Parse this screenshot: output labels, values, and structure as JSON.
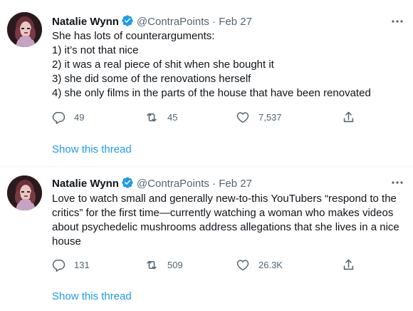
{
  "tweets": [
    {
      "author_name": "Natalie Wynn",
      "handle": "@ContraPoints",
      "separator": "·",
      "date": "Feb 27",
      "text_lines": [
        "She has lots of counterarguments:",
        "1) it’s not that nice",
        "2) it was a real piece of shit when she bought it",
        "3) she did some of the renovations herself",
        "4) she only films in the parts of the house that have been renovated"
      ],
      "replies": "49",
      "retweets": "45",
      "likes": "7,537",
      "show_thread": "Show this thread"
    },
    {
      "author_name": "Natalie Wynn",
      "handle": "@ContraPoints",
      "separator": "·",
      "date": "Feb 27",
      "text": "Love to watch small and generally new-to-this YouTubers “respond to the critics” for the first time—currently watching a woman who makes videos about psychedelic mushrooms address allegations that she lives in a nice house",
      "replies": "131",
      "retweets": "509",
      "likes": "26.3K",
      "show_thread": "Show this thread"
    }
  ],
  "colors": {
    "text": "#0f1419",
    "muted": "#536471",
    "link": "#1d9bf0",
    "verified": "#1d9bf0",
    "divider": "#eff3f4"
  },
  "icons": [
    "verified-badge-icon",
    "more-icon",
    "reply-icon",
    "retweet-icon",
    "like-icon",
    "share-icon"
  ]
}
